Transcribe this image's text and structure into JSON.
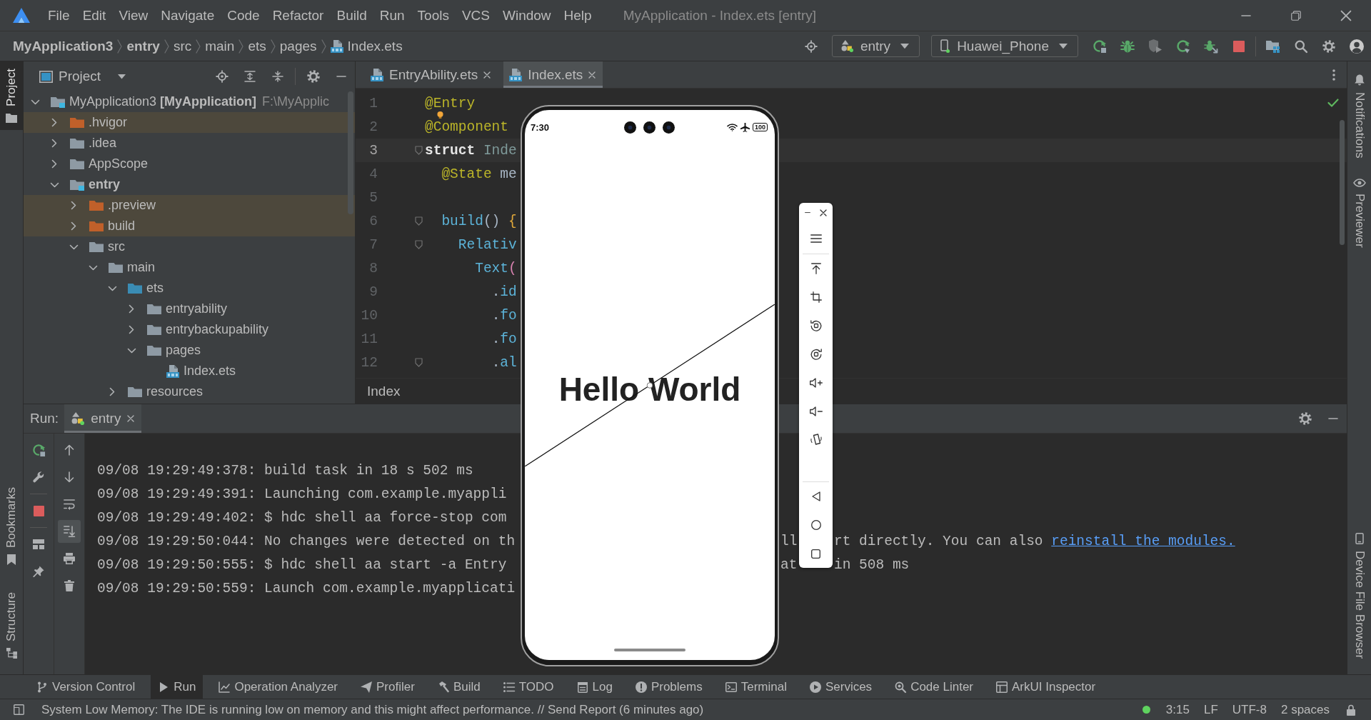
{
  "window": {
    "title": "MyApplication - Index.ets [entry]"
  },
  "menu": [
    "File",
    "Edit",
    "View",
    "Navigate",
    "Code",
    "Refactor",
    "Build",
    "Run",
    "Tools",
    "VCS",
    "Window",
    "Help"
  ],
  "breadcrumb": [
    {
      "label": "MyApplication3",
      "kind": "module"
    },
    {
      "label": "entry",
      "kind": "module"
    },
    {
      "label": "src",
      "kind": "folder"
    },
    {
      "label": "main",
      "kind": "folder"
    },
    {
      "label": "ets",
      "kind": "folder"
    },
    {
      "label": "pages",
      "kind": "folder"
    },
    {
      "label": "Index.ets",
      "kind": "file"
    }
  ],
  "toolbar": {
    "run_configuration": "entry",
    "device": "Huawei_Phone"
  },
  "left_tools": {
    "top": [
      {
        "label": "Project",
        "selected": true
      }
    ],
    "bottom": [
      {
        "label": "Bookmarks",
        "selected": false
      },
      {
        "label": "Structure",
        "selected": false
      }
    ]
  },
  "right_tools": {
    "top": [
      {
        "label": "Notifications",
        "selected": false
      },
      {
        "label": "Previewer",
        "selected": false
      }
    ],
    "bottom": [
      {
        "label": "Device File Browser",
        "selected": false
      }
    ]
  },
  "project": {
    "title": "Project",
    "tree": [
      {
        "label": "MyApplication3 **[MyApplication]**",
        "path": "F:\\MyApplic",
        "kind": "root",
        "expanded": true,
        "children": [
          {
            "label": ".hvigor",
            "kind": "excluded",
            "expanded": false
          },
          {
            "label": ".idea",
            "kind": "folder",
            "expanded": false
          },
          {
            "label": "AppScope",
            "kind": "folder",
            "expanded": false
          },
          {
            "label": "entry",
            "kind": "module",
            "expanded": true,
            "children": [
              {
                "label": ".preview",
                "kind": "excluded",
                "expanded": false
              },
              {
                "label": "build",
                "kind": "excluded",
                "expanded": false
              },
              {
                "label": "src",
                "kind": "folder",
                "expanded": true,
                "children": [
                  {
                    "label": "main",
                    "kind": "folder",
                    "expanded": true,
                    "children": [
                      {
                        "label": "ets",
                        "kind": "source",
                        "expanded": true,
                        "children": [
                          {
                            "label": "entryability",
                            "kind": "folder",
                            "expanded": false
                          },
                          {
                            "label": "entrybackupability",
                            "kind": "folder",
                            "expanded": false
                          },
                          {
                            "label": "pages",
                            "kind": "folder",
                            "expanded": true,
                            "children": [
                              {
                                "label": "Index.ets",
                                "kind": "file"
                              }
                            ]
                          }
                        ]
                      },
                      {
                        "label": "resources",
                        "kind": "folder",
                        "expanded": false
                      }
                    ]
                  }
                ]
              }
            ]
          }
        ]
      }
    ]
  },
  "editor": {
    "tabs": [
      {
        "label": "EntryAbility.ets",
        "selected": false
      },
      {
        "label": "Index.ets",
        "selected": true
      }
    ],
    "lines": [
      {
        "number": "1",
        "current": false,
        "fold": false,
        "bulb": false,
        "tokens": [
          {
            "text": "@Entry",
            "kind": "annotation"
          }
        ]
      },
      {
        "number": "2",
        "current": false,
        "fold": false,
        "bulb": true,
        "tokens": [
          {
            "text": "@Component",
            "kind": "annotation"
          }
        ]
      },
      {
        "number": "3",
        "current": true,
        "fold": true,
        "bulb": false,
        "tokens": [
          {
            "text": "struct",
            "kind": "keyword"
          },
          {
            "text": " Inde",
            "kind": "type"
          }
        ]
      },
      {
        "number": "4",
        "current": false,
        "fold": false,
        "bulb": false,
        "tokens": [
          {
            "text": "  @State",
            "kind": "annotation"
          },
          {
            "text": " me",
            "kind": "plain"
          }
        ]
      },
      {
        "number": "5",
        "current": false,
        "fold": false,
        "bulb": false
      },
      {
        "number": "6",
        "current": false,
        "fold": true,
        "bulb": false,
        "tokens": [
          {
            "text": "  build",
            "kind": "function"
          },
          {
            "text": "()",
            "kind": "plain"
          },
          {
            "text": " {",
            "kind": "brace"
          }
        ]
      },
      {
        "number": "7",
        "current": false,
        "fold": true,
        "bulb": false,
        "tokens": [
          {
            "text": "    Relativ",
            "kind": "function"
          }
        ]
      },
      {
        "number": "8",
        "current": false,
        "fold": false,
        "bulb": false,
        "tokens": [
          {
            "text": "      Text",
            "kind": "function"
          },
          {
            "text": "(",
            "kind": "paren"
          }
        ]
      },
      {
        "number": "9",
        "current": false,
        "fold": false,
        "bulb": false,
        "tokens": [
          {
            "text": "        .",
            "kind": "plain"
          },
          {
            "text": "id",
            "kind": "function"
          }
        ]
      },
      {
        "number": "10",
        "current": false,
        "fold": false,
        "bulb": false,
        "tokens": [
          {
            "text": "        .",
            "kind": "plain"
          },
          {
            "text": "fo",
            "kind": "function"
          }
        ]
      },
      {
        "number": "11",
        "current": false,
        "fold": false,
        "bulb": false,
        "tokens": [
          {
            "text": "        .",
            "kind": "plain"
          },
          {
            "text": "fo",
            "kind": "function"
          }
        ]
      },
      {
        "number": "12",
        "current": false,
        "fold": true,
        "bulb": false,
        "tokens": [
          {
            "text": "        .",
            "kind": "plain"
          },
          {
            "text": "al",
            "kind": "function"
          }
        ]
      }
    ],
    "breadcrumb": "Index"
  },
  "emulator": {
    "time": "7:30",
    "battery": "100",
    "text": "Hello World"
  },
  "run": {
    "label": "Run:",
    "tabs": [
      {
        "label": "entry",
        "selected": true
      }
    ],
    "scroll_to_end": true,
    "lines": [
      {
        "text": "09/08 19:29:49:378: build task in 18 s 502 ms"
      },
      {
        "text": "09/08 19:29:49:391: Launching com.example.myappli"
      },
      {
        "text": "09/08 19:29:49:402: $ hdc shell aa force-stop com"
      },
      {
        "text": "09/08 19:29:50:044: No changes were detected on th",
        "beside_phone": "ll",
        "beside_toolbar": "rt directly. You can also",
        "link": "reinstall the modules."
      },
      {
        "text": "09/08 19:29:50:555: $ hdc shell aa start -a Entry",
        "beside_phone": "at",
        "beside_toolbar": "in 508 ms"
      },
      {
        "text": "09/08 19:29:50:559: Launch com.example.myapplicati"
      }
    ]
  },
  "tool_windows": [
    {
      "label": "Version Control",
      "selected": false
    },
    {
      "label": "Run",
      "selected": true
    },
    {
      "label": "Operation Analyzer",
      "selected": false
    },
    {
      "label": "Profiler",
      "selected": false
    },
    {
      "label": "Build",
      "selected": false
    },
    {
      "label": "TODO",
      "selected": false
    },
    {
      "label": "Log",
      "selected": false
    },
    {
      "label": "Problems",
      "selected": false
    },
    {
      "label": "Terminal",
      "selected": false
    },
    {
      "label": "Services",
      "selected": false
    },
    {
      "label": "Code Linter",
      "selected": false
    },
    {
      "label": "ArkUI Inspector",
      "selected": false
    }
  ],
  "status_bar": {
    "message": "System Low Memory: The IDE is running low on memory and this might affect performance. // Send Report (6 minutes ago)",
    "position": "3:15",
    "line_separator": "LF",
    "encoding": "UTF-8",
    "indent": "2 spaces"
  }
}
